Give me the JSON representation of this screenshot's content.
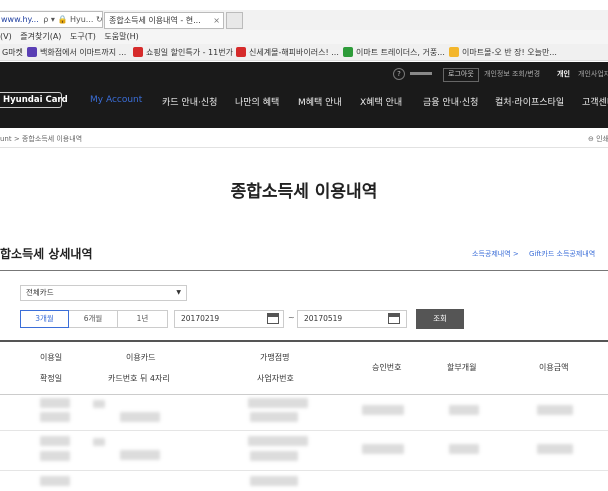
{
  "browser": {
    "address": "www.hy...",
    "address_icons": "ρ ▾ 🔒 Hyu... ↻",
    "tab_title": "종합소득세 이용내역 - 현...",
    "tab_close": "×",
    "menu": [
      "(V)",
      "즐겨찾기(A)",
      "도구(T)",
      "도움말(H)"
    ],
    "favorites": [
      {
        "label": "G마켓",
        "color": "#ffffff"
      },
      {
        "label": "백화점에서 이마트까지 ...",
        "color": "#5a3fb5"
      },
      {
        "label": "쇼핑일 할인특가 - 11번가",
        "color": "#d62b2b"
      },
      {
        "label": "신세계몰-해피바이러스! ...",
        "color": "#d62b2b"
      },
      {
        "label": "이마트 트레이더스, 거풍...",
        "color": "#2e9c3a"
      },
      {
        "label": "이마트몰-오 반 장! 오늘만...",
        "color": "#f3b62c"
      }
    ]
  },
  "header": {
    "help": "?",
    "logout": "로그아웃",
    "info": "개인정보 조회/변경",
    "personal": "개인",
    "corporate": "개인사업자",
    "logo": "Hyundai Card",
    "nav": [
      "My Account",
      "카드 안내·신청",
      "나만의 혜택",
      "M혜택 안내",
      "X혜택 안내",
      "금융 안내·신청",
      "컬처·라이프스타일",
      "고객센터"
    ]
  },
  "breadcrumb": "unt > 종합소득세 이용내역",
  "print_label": "⊖ 인쇄",
  "page_title": "종합소득세 이용내역",
  "section_title": "합소득세 상세내역",
  "links": [
    "소득공제내역 >",
    "Gift카드 소득공제내역"
  ],
  "filter": {
    "card": "전체카드",
    "periods": [
      "3개월",
      "6개월",
      "1년"
    ],
    "start_date": "20170219",
    "end_date": "20170519",
    "tilde": "~",
    "search": "조회"
  },
  "table": {
    "headers": {
      "date": "이용일",
      "confirm_date": "확정일",
      "card": "이용카드",
      "card_last4": "카드번호 뒤 4자리",
      "merchant": "가맹점명",
      "biz_no": "사업자번호",
      "approval": "승인번호",
      "installment": "할부개월",
      "amount": "이용금액"
    }
  },
  "colors": {
    "header_bg": "#1a1a1a",
    "accent": "#3b6ed8",
    "button_bg": "#555555"
  }
}
